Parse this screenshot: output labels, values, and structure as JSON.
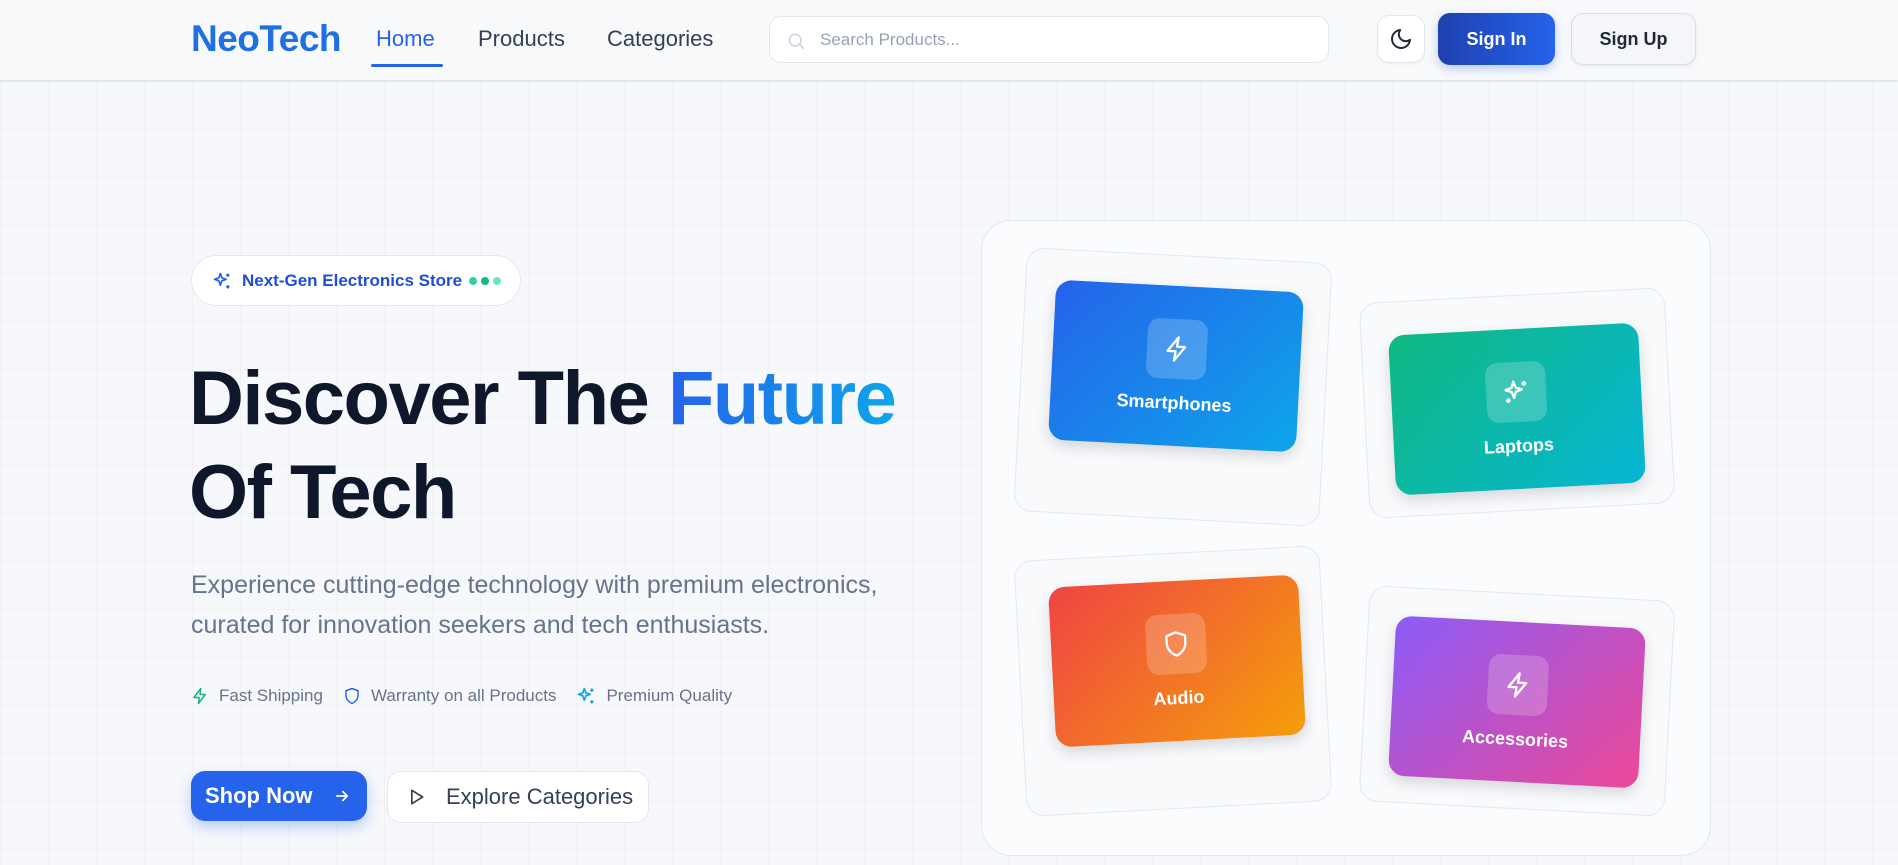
{
  "header": {
    "logo": "NeoTech",
    "nav": [
      {
        "label": "Home",
        "active": true
      },
      {
        "label": "Products",
        "active": false
      },
      {
        "label": "Categories",
        "active": false
      }
    ],
    "search_placeholder": "Search Products...",
    "theme_toggle_icon": "moon-icon",
    "signin_label": "Sign In",
    "signup_label": "Sign Up"
  },
  "hero": {
    "badge": "Next-Gen Electronics Store",
    "title_part1": "Discover The",
    "title_accent": "Future",
    "title_part2": "Of Tech",
    "description": "Experience cutting-edge technology with premium electronics, curated for innovation seekers and tech enthusiasts.",
    "features": [
      {
        "label": "Fast Shipping",
        "icon": "zap-icon"
      },
      {
        "label": "Warranty on all Products",
        "icon": "shield-icon"
      },
      {
        "label": "Premium Quality",
        "icon": "sparkles-icon"
      }
    ],
    "primary_cta": "Shop Now",
    "secondary_cta": "Explore Categories"
  },
  "categories": [
    {
      "label": "Smartphones",
      "icon": "zap-icon",
      "gradient": [
        "#2563eb",
        "#0ea5e9"
      ]
    },
    {
      "label": "Laptops",
      "icon": "sparkles-icon",
      "gradient": [
        "#10b981",
        "#06b6d4"
      ]
    },
    {
      "label": "Audio",
      "icon": "shield-icon",
      "gradient": [
        "#ef4444",
        "#f59e0b"
      ]
    },
    {
      "label": "Accessories",
      "icon": "zap-icon",
      "gradient": [
        "#8b5cf6",
        "#ec4899"
      ]
    }
  ],
  "colors": {
    "brand": "#1f6fe5",
    "primary": "#2563eb",
    "accent_green": "#10b981"
  }
}
